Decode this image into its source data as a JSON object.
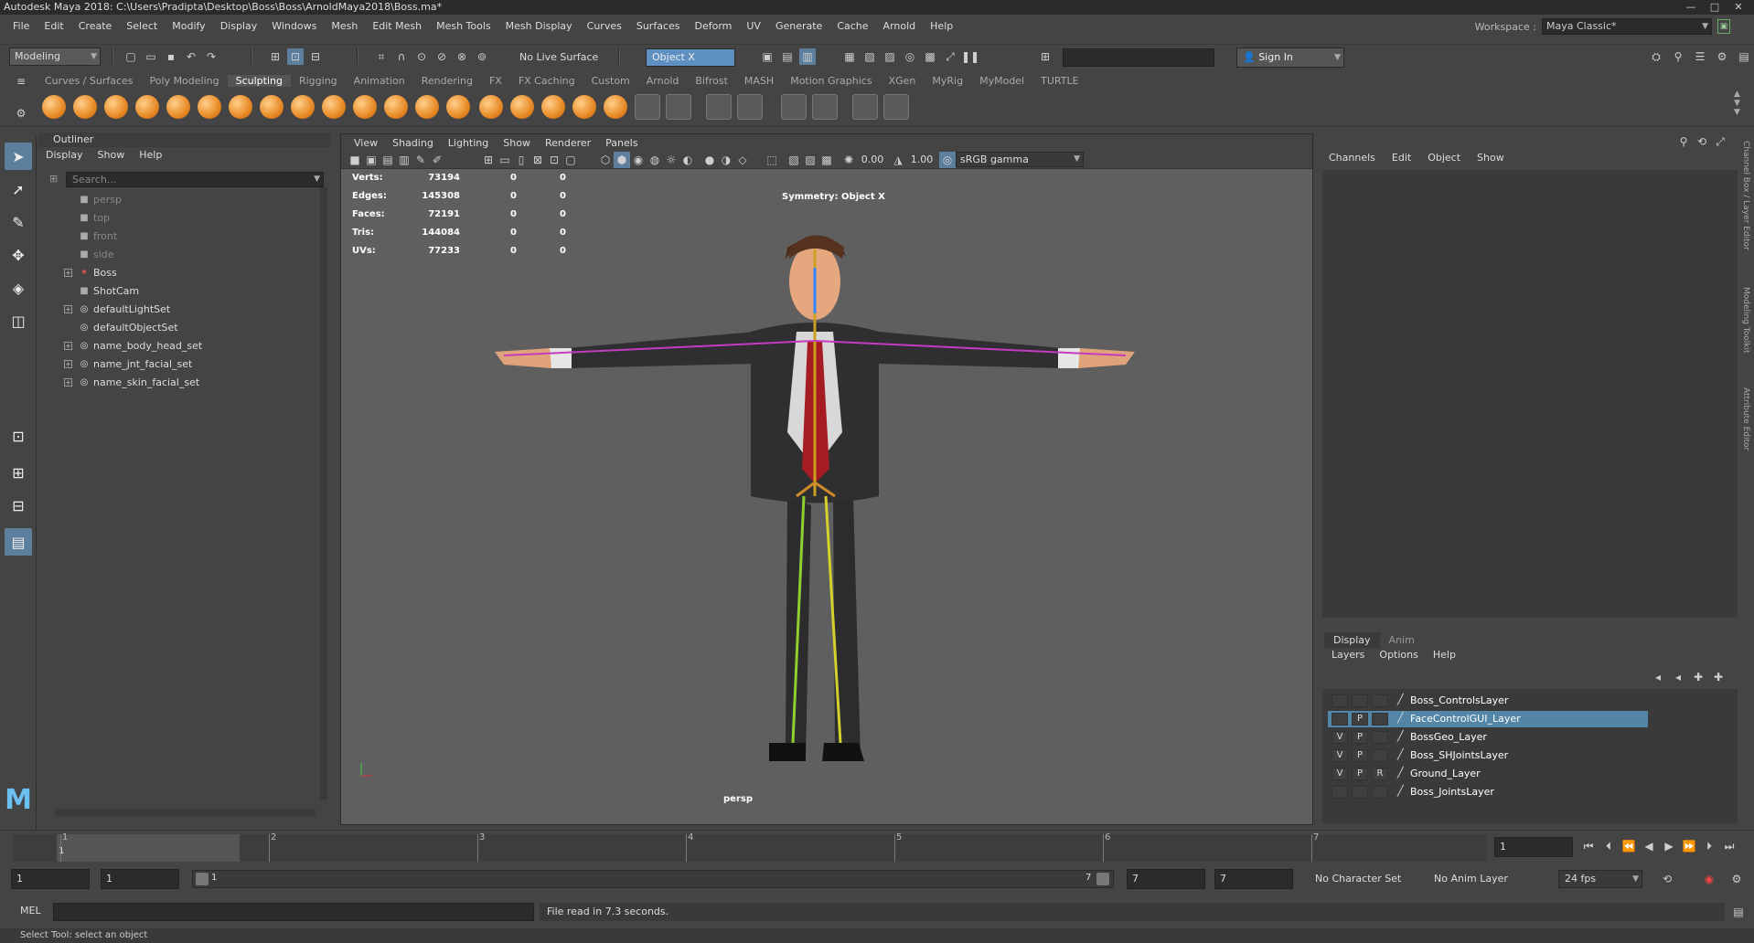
{
  "window": {
    "title": "Autodesk Maya 2018: C:\\Users\\Pradipta\\Desktop\\Boss\\Boss\\ArnoldMaya2018\\Boss.ma*",
    "controls": [
      "—",
      "□",
      "✕"
    ]
  },
  "menubar": {
    "items": [
      "File",
      "Edit",
      "Create",
      "Select",
      "Modify",
      "Display",
      "Windows",
      "Mesh",
      "Edit Mesh",
      "Mesh Tools",
      "Mesh Display",
      "Curves",
      "Surfaces",
      "Deform",
      "UV",
      "Generate",
      "Cache",
      "Arnold",
      "Help"
    ],
    "workspace_label": "Workspace :",
    "workspace_value": "Maya Classic*"
  },
  "statusline": {
    "menuset": "Modeling",
    "live_surface": "No Live Surface",
    "symmetry": "Object X",
    "sign_in": "Sign In"
  },
  "shelf": {
    "tabs": [
      "Curves / Surfaces",
      "Poly Modeling",
      "Sculpting",
      "Rigging",
      "Animation",
      "Rendering",
      "FX",
      "FX Caching",
      "Custom",
      "Arnold",
      "Bifrost",
      "MASH",
      "Motion Graphics",
      "XGen",
      "MyRig",
      "MyModel",
      "TURTLE"
    ],
    "active_tab": "Sculpting"
  },
  "outliner": {
    "title": "Outliner",
    "menu": [
      "Display",
      "Show",
      "Help"
    ],
    "search_placeholder": "Search...",
    "items": [
      {
        "label": "persp",
        "icon": "camera-icon",
        "expandable": false,
        "dim": true
      },
      {
        "label": "top",
        "icon": "camera-icon",
        "expandable": false,
        "dim": true
      },
      {
        "label": "front",
        "icon": "camera-icon",
        "expandable": false,
        "dim": true
      },
      {
        "label": "side",
        "icon": "camera-icon",
        "expandable": false,
        "dim": true
      },
      {
        "label": "Boss",
        "icon": "joint-icon",
        "expandable": true,
        "dim": false
      },
      {
        "label": "ShotCam",
        "icon": "camera-icon",
        "expandable": false,
        "dim": false
      },
      {
        "label": "defaultLightSet",
        "icon": "set-icon",
        "expandable": true,
        "dim": false
      },
      {
        "label": "defaultObjectSet",
        "icon": "set-icon",
        "expandable": false,
        "dim": false
      },
      {
        "label": "name_body_head_set",
        "icon": "set-icon",
        "expandable": true,
        "dim": false
      },
      {
        "label": "name_jnt_facial_set",
        "icon": "set-icon",
        "expandable": true,
        "dim": false
      },
      {
        "label": "name_skin_facial_set",
        "icon": "set-icon",
        "expandable": true,
        "dim": false
      }
    ]
  },
  "viewport": {
    "menu": [
      "View",
      "Shading",
      "Lighting",
      "Show",
      "Renderer",
      "Panels"
    ],
    "near_value": "0.00",
    "far_value": "1.00",
    "colorspace": "sRGB gamma",
    "hud_labels": [
      "Verts:",
      "Edges:",
      "Faces:",
      "Tris:",
      "UVs:"
    ],
    "hud_values": [
      [
        "73194",
        "0",
        "0"
      ],
      [
        "145308",
        "0",
        "0"
      ],
      [
        "72191",
        "0",
        "0"
      ],
      [
        "144084",
        "0",
        "0"
      ],
      [
        "77233",
        "0",
        "0"
      ]
    ],
    "symmetry_label": "Symmetry: Object X",
    "camera_label": "persp"
  },
  "channelbox": {
    "menu": [
      "Channels",
      "Edit",
      "Object",
      "Show"
    ]
  },
  "sidetabs": [
    "Channel Box / Layer Editor",
    "Modeling Toolkit",
    "Attribute Editor"
  ],
  "layers": {
    "tabs": [
      "Display",
      "Anim"
    ],
    "menu": [
      "Layers",
      "Options",
      "Help"
    ],
    "rows": [
      {
        "v": "",
        "p": "",
        "r": "",
        "name": "Boss_ControlsLayer",
        "selected": false
      },
      {
        "v": "",
        "p": "P",
        "r": "",
        "name": "FaceControlGUI_Layer",
        "selected": true
      },
      {
        "v": "V",
        "p": "P",
        "r": "",
        "name": "BossGeo_Layer",
        "selected": false
      },
      {
        "v": "V",
        "p": "P",
        "r": "",
        "name": "Boss_SHJointsLayer",
        "selected": false
      },
      {
        "v": "V",
        "p": "P",
        "r": "R",
        "name": "Ground_Layer",
        "selected": false
      },
      {
        "v": "",
        "p": "",
        "r": "",
        "name": "Boss_JointsLayer",
        "selected": false
      }
    ]
  },
  "timeline": {
    "ticks": [
      "1",
      "2",
      "3",
      "4",
      "5",
      "6",
      "7"
    ],
    "current_frame": "1",
    "current_frame_marker": "1"
  },
  "range": {
    "start": "1",
    "playback_start": "1",
    "slider_start": "1",
    "slider_end": "7",
    "playback_end": "7",
    "end": "7",
    "character_set": "No Character Set",
    "anim_layer": "No Anim Layer",
    "fps": "24 fps"
  },
  "cmdline": {
    "label": "MEL",
    "result": "File read in  7.3 seconds."
  },
  "helpline": "Select Tool: select an object",
  "colors": {
    "selection": "#5285a6",
    "symmetry_field": "#5d8fc1",
    "viewport_bg": "#5f5f5f",
    "shelf_orange": "#e88a25"
  }
}
